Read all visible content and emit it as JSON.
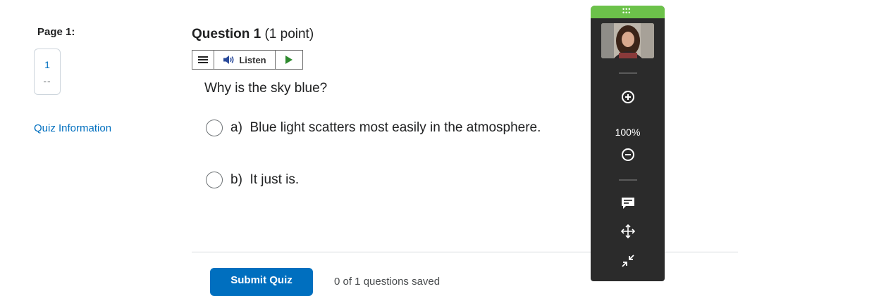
{
  "nav": {
    "page_label": "Page 1:",
    "page_number": "1",
    "page_status": "--",
    "quiz_info_link": "Quiz Information"
  },
  "question": {
    "title_bold": "Question 1",
    "points": " (1 point)",
    "text": "Why is the sky blue?",
    "options": [
      {
        "letter": "a)",
        "text": "Blue light scatters most easily in the atmosphere."
      },
      {
        "letter": "b)",
        "text": "It just is."
      }
    ]
  },
  "listen_bar": {
    "menu_icon": "menu-icon",
    "speaker_icon": "speaker-icon",
    "label": "Listen",
    "play_icon": "play-icon"
  },
  "footer": {
    "submit_label": "Submit Quiz",
    "answered_text": "0 of 1 questions saved"
  },
  "toolbar": {
    "handle_icon": "drag-grip-icon",
    "zoom_in_icon": "zoom-in-icon",
    "zoom_level": "100%",
    "zoom_out_icon": "zoom-out-icon",
    "chat_icon": "chat-icon",
    "move_icon": "move-icon",
    "collapse_icon": "collapse-icon",
    "accent_color": "#6cc24a",
    "background_color": "#2b2b2b"
  },
  "colors": {
    "link": "#006fbf",
    "primary_button": "#006fbf",
    "play_green": "#2e8a2e"
  }
}
